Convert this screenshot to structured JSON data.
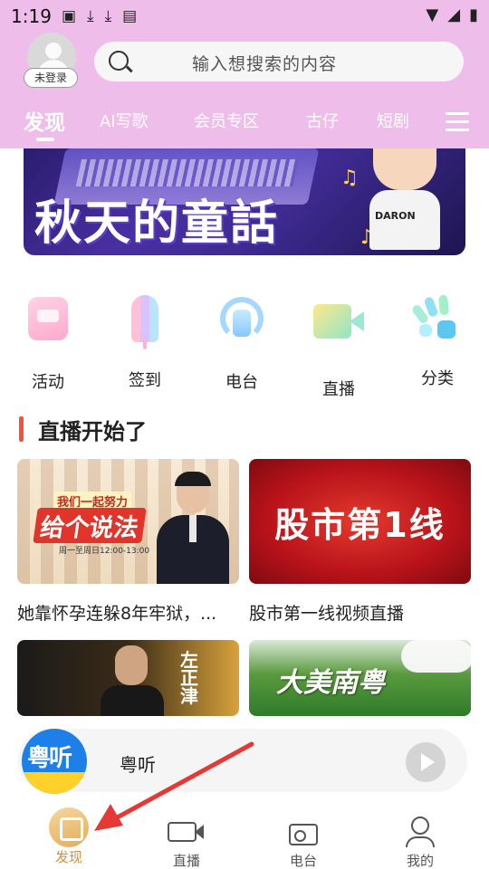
{
  "status_bar": {
    "time": "1:19",
    "icons": [
      "image-icon",
      "download-icon",
      "download-icon",
      "a-icon"
    ],
    "right_icons": [
      "wifi-icon",
      "signal-icon",
      "battery-icon"
    ]
  },
  "header": {
    "avatar_label": "未登录",
    "search_placeholder": "输入想搜索的内容",
    "background_color": "#efbde9",
    "tabs": [
      {
        "label": "发现",
        "active": true
      },
      {
        "label": "AI写歌",
        "active": false
      },
      {
        "label": "会员专区",
        "active": false
      },
      {
        "label": "古仔",
        "active": false
      },
      {
        "label": "短剧",
        "active": false
      }
    ],
    "menu_icon": "menu-icon"
  },
  "banner": {
    "title": "秋天的童話",
    "shirt_text": "DARON"
  },
  "quick_icons": [
    {
      "label": "活动",
      "icon": "activity-icon"
    },
    {
      "label": "签到",
      "icon": "checkin-icon"
    },
    {
      "label": "电台",
      "icon": "radio-icon"
    },
    {
      "label": "直播",
      "icon": "live-icon"
    },
    {
      "label": "分类",
      "icon": "category-icon"
    }
  ],
  "section": {
    "title": "直播开始了",
    "accent_color": "#f2533b"
  },
  "live_cards": [
    {
      "title": "她靠怀孕连躲8年牢狱，...",
      "thumb_slogan_top": "我们一起努力",
      "thumb_slogan_main": "给个说法",
      "thumb_sub": "周一至周日12:00-13:00"
    },
    {
      "title": "股市第一线视频直播",
      "thumb_text": "股市第1线"
    },
    {
      "title": "",
      "thumb_text": "左正津"
    },
    {
      "title": "",
      "thumb_text": "大美南粤"
    }
  ],
  "mini_player": {
    "logo_text": "粤听",
    "title": "粤听",
    "play_icon": "play-icon"
  },
  "bottom_nav": [
    {
      "label": "发现",
      "icon": "discover-icon",
      "active": true
    },
    {
      "label": "直播",
      "icon": "video-icon",
      "active": false
    },
    {
      "label": "电台",
      "icon": "radio-icon",
      "active": false
    },
    {
      "label": "我的",
      "icon": "user-icon",
      "active": false
    }
  ],
  "colors": {
    "active_nav": "#c89147",
    "annotation_arrow": "#e53935"
  }
}
